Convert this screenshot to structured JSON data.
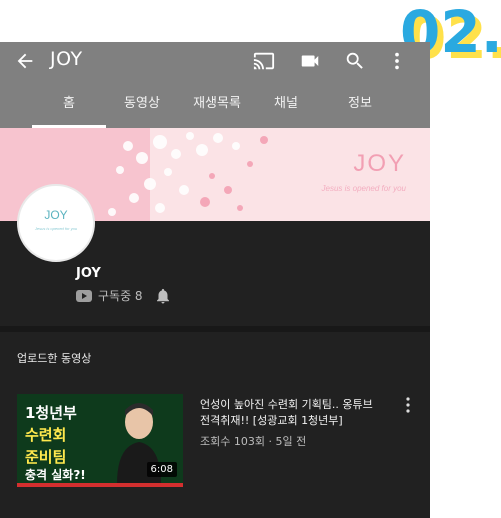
{
  "step_badge": "02.",
  "appbar": {
    "title": "JOY",
    "icons": [
      "back-arrow-icon",
      "cast-icon",
      "video-camera-icon",
      "search-icon",
      "more-vert-icon"
    ]
  },
  "tabs": [
    {
      "label": "홈",
      "active": true
    },
    {
      "label": "동영상",
      "active": false
    },
    {
      "label": "재생목록",
      "active": false
    },
    {
      "label": "채널",
      "active": false
    },
    {
      "label": "정보",
      "active": false
    }
  ],
  "banner": {
    "brand": "JOY",
    "tagline": "Jesus is opened for you"
  },
  "avatar": {
    "name": "JOY",
    "sub": "Jesus is opened for you"
  },
  "channel": {
    "name": "JOY",
    "subscribers": "구독중 8"
  },
  "section": {
    "title": "업로드한 동영상"
  },
  "video": {
    "thumb_lines": [
      "1청년부",
      "수련회",
      "준비팀",
      "충격 실화?!"
    ],
    "duration": "6:08",
    "title": "언성이 높아진 수련회 기획팀.. 옹튜브 전격취재!! [성광교회 1청년부]",
    "meta": "조회수 103회 · 5일 전"
  },
  "colors": {
    "appbar": "#808080",
    "dark_bg": "#212121",
    "banner_bg": "#fbe3e6",
    "badge_blue": "#2aa9e0",
    "badge_yellow": "#ffe14a"
  }
}
